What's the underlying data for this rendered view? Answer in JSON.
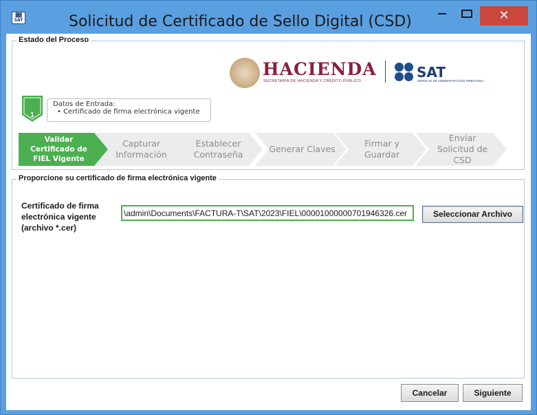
{
  "window": {
    "title": "Solicitud de Certificado de Sello Digital (CSD)",
    "app_icon_text": "SAT",
    "minimize_label": "",
    "maximize_label": "",
    "close_label": "✕"
  },
  "process": {
    "legend": "Estado del Proceso",
    "logos": {
      "hacienda": "HACIENDA",
      "hacienda_sub": "SECRETARÍA DE HACIENDA Y CRÉDITO PÚBLICO",
      "sat": "SAT",
      "sat_sub": "SERVICIO DE ADMINISTRACIÓN TRIBUTARIA"
    },
    "current_step_number": "1",
    "info_title": "Datos de Entrada:",
    "info_item": "•   Certificado de firma electrónica vigente",
    "steps": [
      {
        "label": "Validar Certificado de FIEL Vigente",
        "active": true
      },
      {
        "label": "Capturar Información",
        "active": false
      },
      {
        "label": "Establecer Contraseña",
        "active": false
      },
      {
        "label": "Generar Claves",
        "active": false
      },
      {
        "label": "Firmar y Guardar",
        "active": false
      },
      {
        "label": "Enviar Solicitud de CSD",
        "active": false
      }
    ],
    "colors": {
      "active": "#4caf50",
      "inactive": "#ececec",
      "step_badge": "#4caf50"
    }
  },
  "certificate": {
    "legend": "Proporcione su certificado de firma electrónica vigente",
    "field_label": "Certificado de firma electrónica vigente (archivo *.cer)",
    "path_value": "\\admin\\Documents\\FACTURA-T\\SAT\\2023\\FIEL\\00001000000701946326.cer",
    "select_button": "Seleccionar Archivo"
  },
  "footer": {
    "cancel": "Cancelar",
    "next": "Siguiente"
  }
}
